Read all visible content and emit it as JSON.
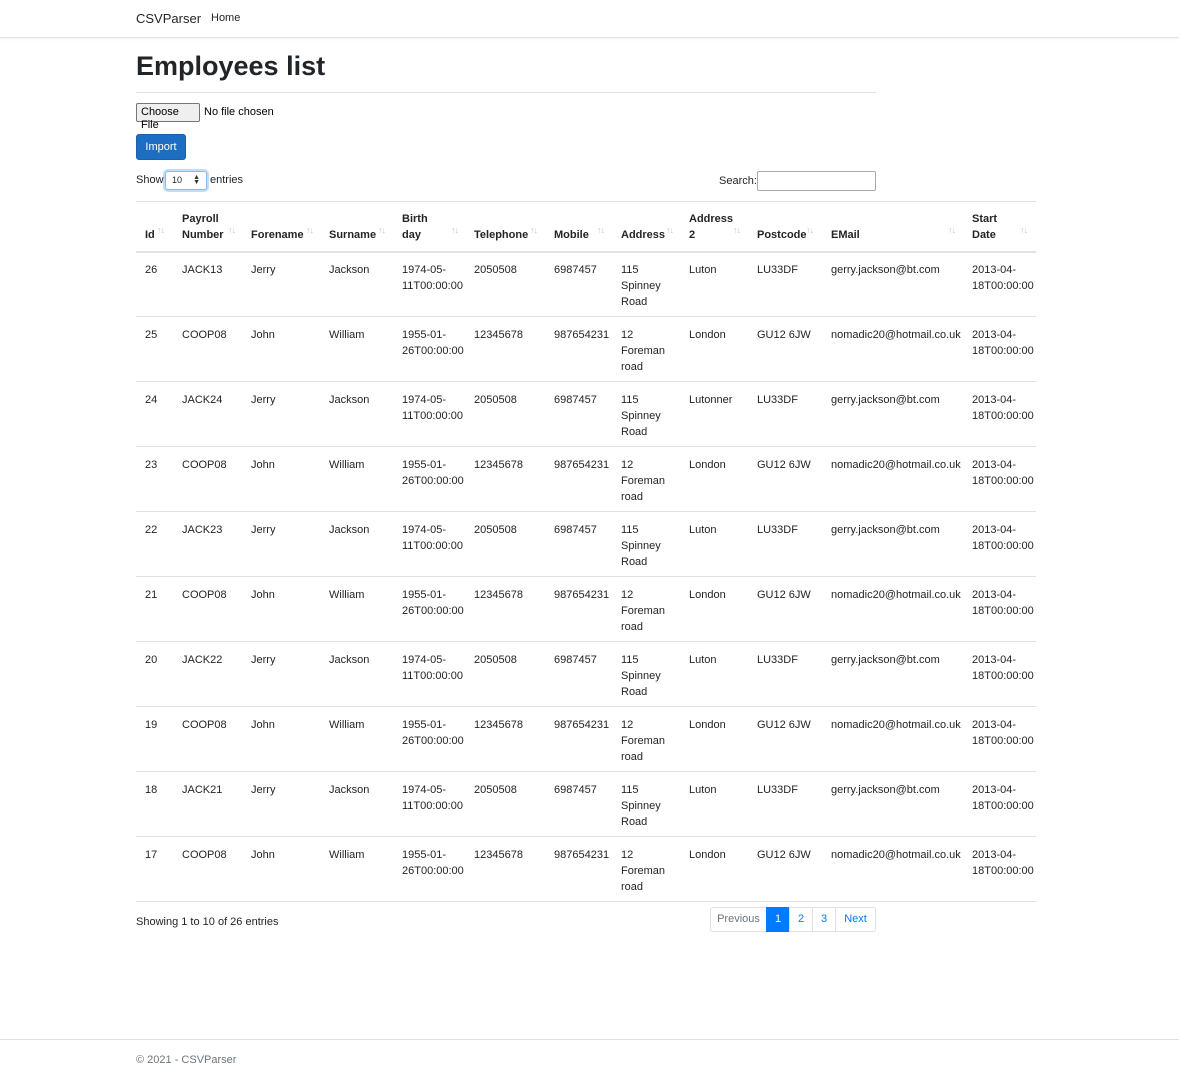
{
  "navbar": {
    "brand": "CSVParser",
    "links": [
      "Home"
    ]
  },
  "page": {
    "title": "Employees list"
  },
  "upload": {
    "choose_label": "Choose File",
    "file_status": "No file chosen",
    "import_label": "Import"
  },
  "length": {
    "show": "Show",
    "value": "10",
    "entries": "entries"
  },
  "search": {
    "label": "Search:",
    "value": ""
  },
  "table": {
    "headers": [
      {
        "l1": "Id",
        "l2": ""
      },
      {
        "l1": "Payroll",
        "l2": "Number"
      },
      {
        "l1": "Forename",
        "l2": ""
      },
      {
        "l1": "Surname",
        "l2": ""
      },
      {
        "l1": "Birth",
        "l2": "day"
      },
      {
        "l1": "Telephone",
        "l2": ""
      },
      {
        "l1": "Mobile",
        "l2": ""
      },
      {
        "l1": "Address",
        "l2": ""
      },
      {
        "l1": "Address",
        "l2": "2"
      },
      {
        "l1": "Postcode",
        "l2": ""
      },
      {
        "l1": "EMail",
        "l2": ""
      },
      {
        "l1": "Start",
        "l2": "Date"
      }
    ],
    "rows": [
      {
        "id": "26",
        "payroll": "JACK13",
        "forename": "Jerry",
        "surname": "Jackson",
        "birth1": "1974-05-",
        "birth2": "11T00:00:00",
        "telephone": "2050508",
        "mobile": "6987457",
        "addr_a": "115",
        "addr_b": "Spinney",
        "addr_c": "Road",
        "address2": "Luton",
        "postcode": "LU33DF",
        "email": "gerry.jackson@bt.com",
        "start1": "2013-04-",
        "start2": "18T00:00:00"
      },
      {
        "id": "25",
        "payroll": "COOP08",
        "forename": "John",
        "surname": "William",
        "birth1": "1955-01-",
        "birth2": "26T00:00:00",
        "telephone": "12345678",
        "mobile": "987654231",
        "addr_a": "12",
        "addr_b": "Foreman",
        "addr_c": "road",
        "address2": "London",
        "postcode": "GU12 6JW",
        "email": "nomadic20@hotmail.co.uk",
        "start1": "2013-04-",
        "start2": "18T00:00:00"
      },
      {
        "id": "24",
        "payroll": "JACK24",
        "forename": "Jerry",
        "surname": "Jackson",
        "birth1": "1974-05-",
        "birth2": "11T00:00:00",
        "telephone": "2050508",
        "mobile": "6987457",
        "addr_a": "115",
        "addr_b": "Spinney",
        "addr_c": "Road",
        "address2": "Lutonner",
        "postcode": "LU33DF",
        "email": "gerry.jackson@bt.com",
        "start1": "2013-04-",
        "start2": "18T00:00:00"
      },
      {
        "id": "23",
        "payroll": "COOP08",
        "forename": "John",
        "surname": "William",
        "birth1": "1955-01-",
        "birth2": "26T00:00:00",
        "telephone": "12345678",
        "mobile": "987654231",
        "addr_a": "12",
        "addr_b": "Foreman",
        "addr_c": "road",
        "address2": "London",
        "postcode": "GU12 6JW",
        "email": "nomadic20@hotmail.co.uk",
        "start1": "2013-04-",
        "start2": "18T00:00:00"
      },
      {
        "id": "22",
        "payroll": "JACK23",
        "forename": "Jerry",
        "surname": "Jackson",
        "birth1": "1974-05-",
        "birth2": "11T00:00:00",
        "telephone": "2050508",
        "mobile": "6987457",
        "addr_a": "115",
        "addr_b": "Spinney",
        "addr_c": "Road",
        "address2": "Luton",
        "postcode": "LU33DF",
        "email": "gerry.jackson@bt.com",
        "start1": "2013-04-",
        "start2": "18T00:00:00"
      },
      {
        "id": "21",
        "payroll": "COOP08",
        "forename": "John",
        "surname": "William",
        "birth1": "1955-01-",
        "birth2": "26T00:00:00",
        "telephone": "12345678",
        "mobile": "987654231",
        "addr_a": "12",
        "addr_b": "Foreman",
        "addr_c": "road",
        "address2": "London",
        "postcode": "GU12 6JW",
        "email": "nomadic20@hotmail.co.uk",
        "start1": "2013-04-",
        "start2": "18T00:00:00"
      },
      {
        "id": "20",
        "payroll": "JACK22",
        "forename": "Jerry",
        "surname": "Jackson",
        "birth1": "1974-05-",
        "birth2": "11T00:00:00",
        "telephone": "2050508",
        "mobile": "6987457",
        "addr_a": "115",
        "addr_b": "Spinney",
        "addr_c": "Road",
        "address2": "Luton",
        "postcode": "LU33DF",
        "email": "gerry.jackson@bt.com",
        "start1": "2013-04-",
        "start2": "18T00:00:00"
      },
      {
        "id": "19",
        "payroll": "COOP08",
        "forename": "John",
        "surname": "William",
        "birth1": "1955-01-",
        "birth2": "26T00:00:00",
        "telephone": "12345678",
        "mobile": "987654231",
        "addr_a": "12",
        "addr_b": "Foreman",
        "addr_c": "road",
        "address2": "London",
        "postcode": "GU12 6JW",
        "email": "nomadic20@hotmail.co.uk",
        "start1": "2013-04-",
        "start2": "18T00:00:00"
      },
      {
        "id": "18",
        "payroll": "JACK21",
        "forename": "Jerry",
        "surname": "Jackson",
        "birth1": "1974-05-",
        "birth2": "11T00:00:00",
        "telephone": "2050508",
        "mobile": "6987457",
        "addr_a": "115",
        "addr_b": "Spinney",
        "addr_c": "Road",
        "address2": "Luton",
        "postcode": "LU33DF",
        "email": "gerry.jackson@bt.com",
        "start1": "2013-04-",
        "start2": "18T00:00:00"
      },
      {
        "id": "17",
        "payroll": "COOP08",
        "forename": "John",
        "surname": "William",
        "birth1": "1955-01-",
        "birth2": "26T00:00:00",
        "telephone": "12345678",
        "mobile": "987654231",
        "addr_a": "12",
        "addr_b": "Foreman",
        "addr_c": "road",
        "address2": "London",
        "postcode": "GU12 6JW",
        "email": "nomadic20@hotmail.co.uk",
        "start1": "2013-04-",
        "start2": "18T00:00:00"
      }
    ]
  },
  "info": "Showing 1 to 10 of 26 entries",
  "pagination": {
    "previous": "Previous",
    "pages": [
      "1",
      "2",
      "3"
    ],
    "active_page": "1",
    "next": "Next"
  },
  "footer": {
    "text": "© 2021 - CSVParser"
  },
  "colors": {
    "primary_button": "#1b6ec2",
    "active_page": "#007bff",
    "link": "#007bff"
  }
}
